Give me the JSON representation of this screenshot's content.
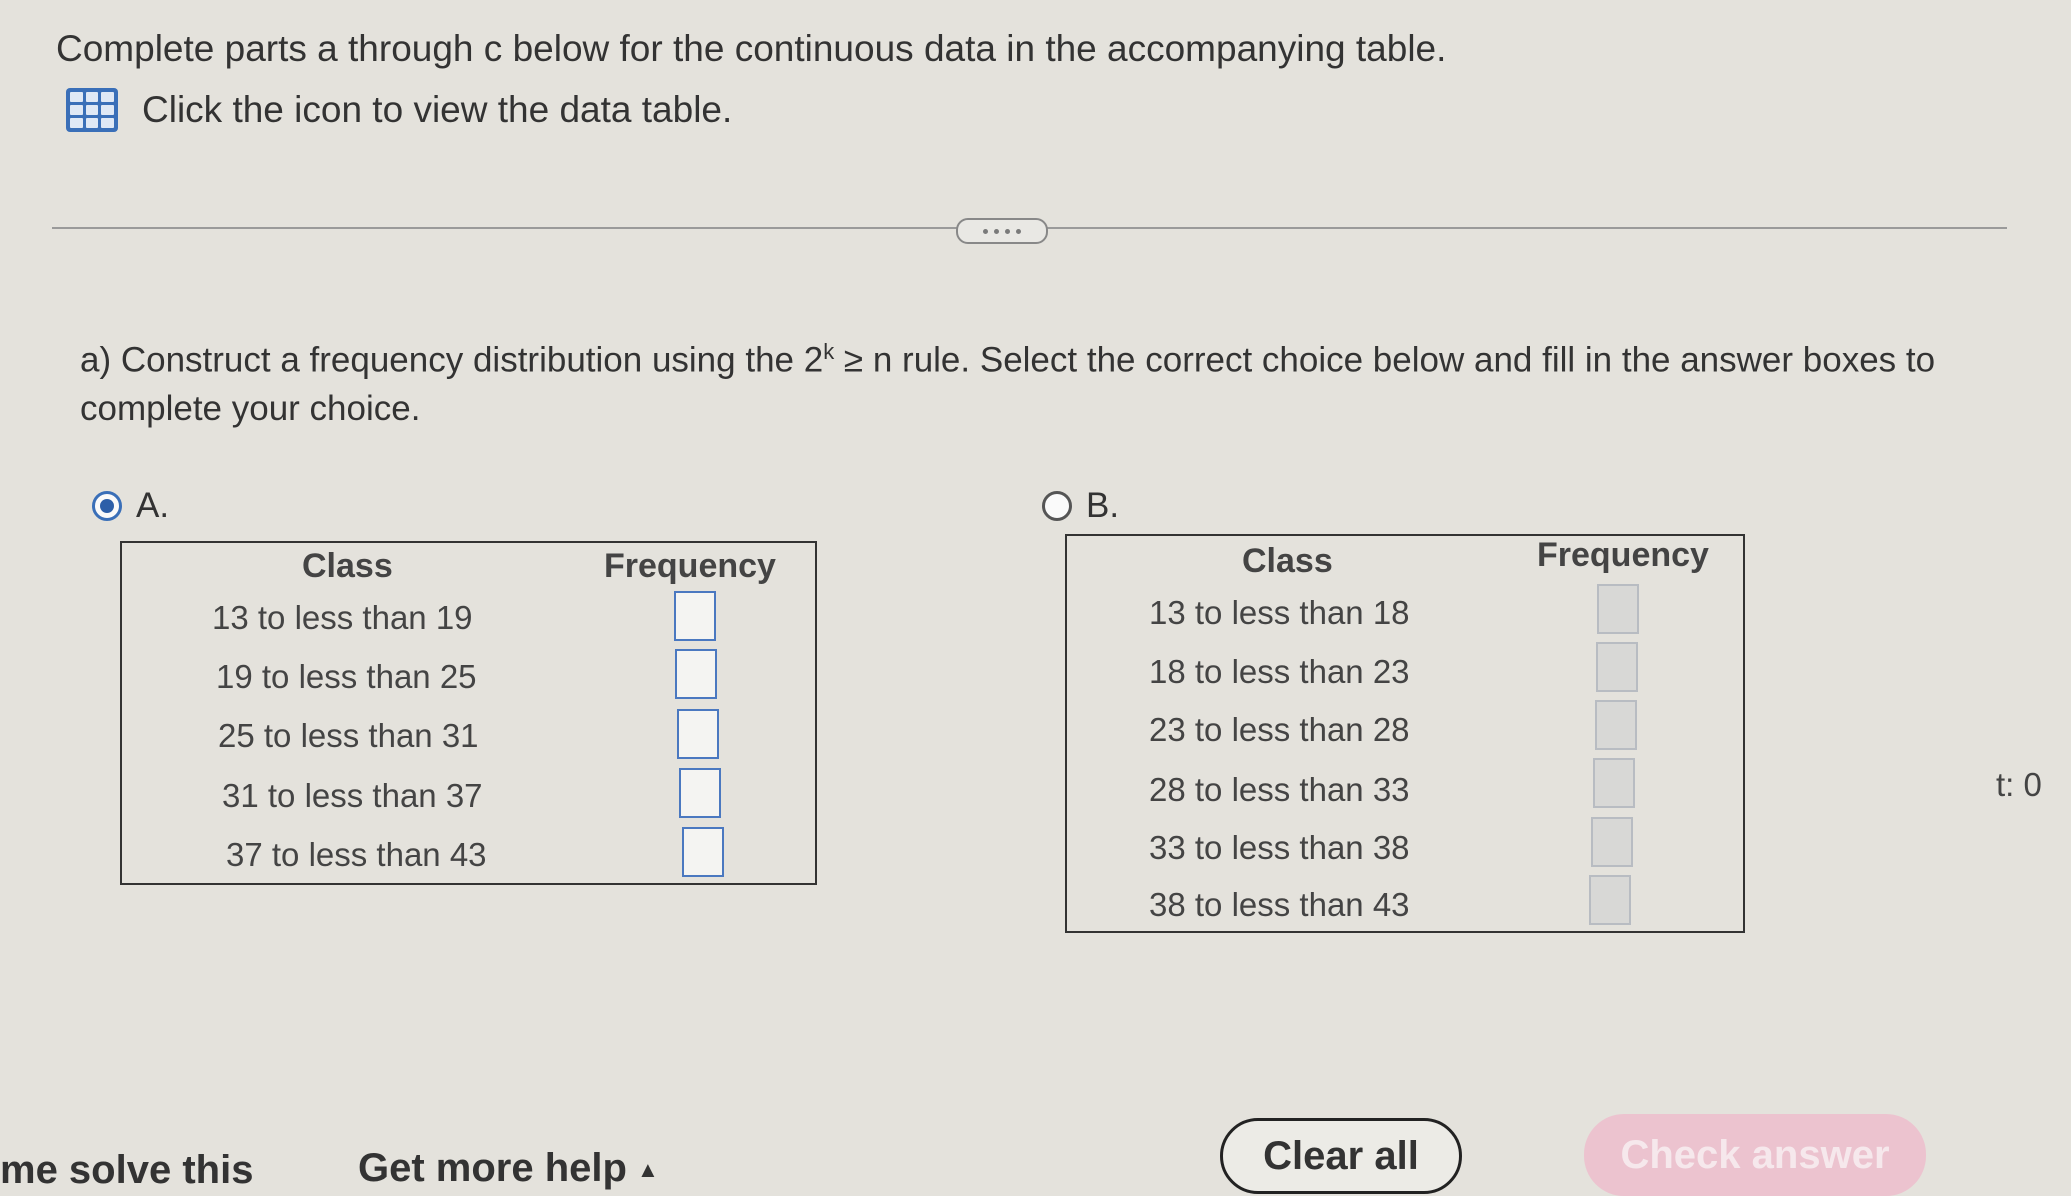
{
  "intro": "Complete parts a through c below for the continuous data in the accompanying table.",
  "data_link": "Click the icon to view the data table.",
  "question": {
    "prefix": "a) Construct a frequency distribution using the 2",
    "exponent": "k",
    "suffix": " ≥ n rule. Select the correct choice below and fill in the answer boxes to complete your choice."
  },
  "choices": [
    {
      "label": "A.",
      "selected": true,
      "class_header": "Class",
      "freq_header": "Frequency",
      "rows": [
        "13 to less than 19",
        "19 to less than 25",
        "25 to less than 31",
        "31 to less than 37",
        "37 to less than 43"
      ]
    },
    {
      "label": "B.",
      "selected": false,
      "class_header": "Class",
      "freq_header": "Frequency",
      "rows": [
        "13 to less than 18",
        "18 to less than 23",
        "23 to less than 28",
        "28 to less than 33",
        "33 to less than 38",
        "38 to less than 43"
      ]
    }
  ],
  "side_text": "t: 0",
  "footer": {
    "solve": "me solve this",
    "help": "Get more help",
    "clear": "Clear all",
    "check": "Check answer"
  },
  "colors": {
    "accent": "#2d5fa8",
    "check_button": "#ecc3cf"
  }
}
